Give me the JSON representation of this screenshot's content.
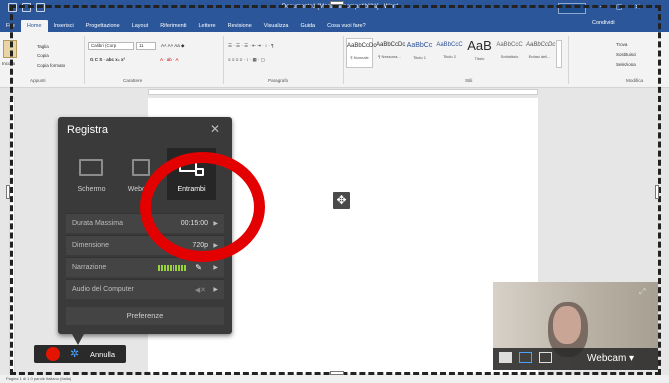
{
  "window": {
    "title": "Documento1 [Modalità compatibilità] - Word",
    "account_button": "",
    "share_label": "Condividi"
  },
  "tabs": [
    "File",
    "Home",
    "Inserisci",
    "Progettazione",
    "Layout",
    "Riferimenti",
    "Lettere",
    "Revisione",
    "Visualizza",
    "Guida",
    "Cosa vuoi fare?"
  ],
  "ribbon": {
    "clipboard": {
      "label": "Appunti",
      "paste": "Incolla",
      "cut": "Taglia",
      "copy": "Copia",
      "format_painter": "Copia formato"
    },
    "font": {
      "label": "Carattere",
      "font_name": "Calibri (Corp",
      "font_size": "11"
    },
    "paragraph": {
      "label": "Paragrafo"
    },
    "styles": {
      "label": "Stili",
      "items": [
        {
          "preview": "AaBbCcDc",
          "name": "¶ Normale"
        },
        {
          "preview": "AaBbCcDc",
          "name": "¶ Nessuna..."
        },
        {
          "preview": "AaBbCc",
          "name": "Titolo 1"
        },
        {
          "preview": "AaBbCcC",
          "name": "Titolo 2"
        },
        {
          "preview": "AaB",
          "name": "Titolo"
        },
        {
          "preview": "AaBbCcC",
          "name": "Sottotitolo"
        },
        {
          "preview": "AaBbCcDc",
          "name": "Enfasi deli..."
        }
      ]
    },
    "editing": {
      "label": "Modifica",
      "find": "Trova",
      "replace": "Sostituisci",
      "select": "Seleziona"
    }
  },
  "status": {
    "left": "Pagina 1 di 1   0 parole   Italiano (Italia)"
  },
  "record_panel": {
    "title": "Registra",
    "modes": [
      {
        "label": "Schermo",
        "selected": false
      },
      {
        "label": "Webcam",
        "selected": false
      },
      {
        "label": "Entrambi",
        "selected": true
      }
    ],
    "rows": [
      {
        "key": "Durata Massima",
        "value": "00:15:00"
      },
      {
        "key": "Dimensione",
        "value": "720p"
      },
      {
        "key": "Narrazione",
        "value": ""
      },
      {
        "key": "Audio del Computer",
        "value": ""
      }
    ],
    "preferences": "Preferenze",
    "cancel": "Annulla"
  },
  "webcam": {
    "label": "Webcam ▾"
  },
  "colors": {
    "word_blue": "#2b579a",
    "panel": "#3a3a3a",
    "record_red": "#e51400",
    "highlight_circle": "#e30000",
    "level_green": "#9ad23a"
  }
}
